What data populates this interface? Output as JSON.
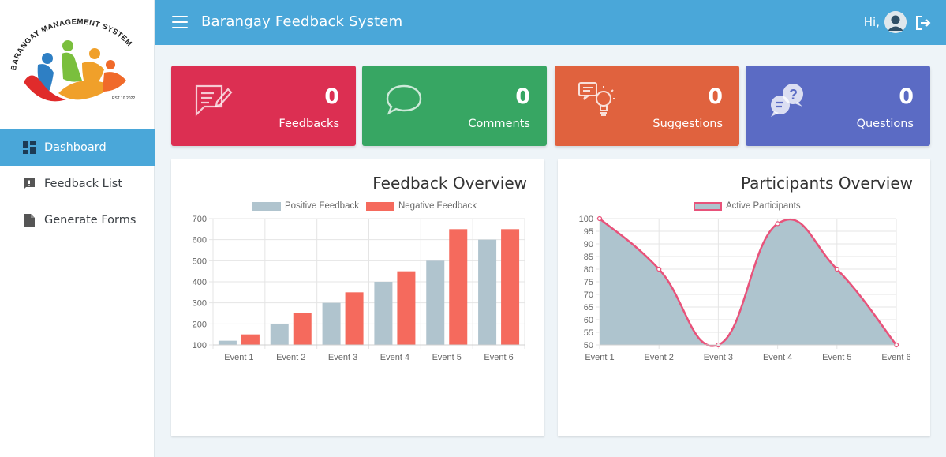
{
  "header": {
    "app_title": "Barangay Feedback System",
    "greeting": "Hi,"
  },
  "logo": {
    "text": "BARANGAY MANAGEMENT SYSTEM",
    "est": "EST 10 2022"
  },
  "sidebar": {
    "items": [
      {
        "label": "Dashboard",
        "icon": "dashboard-icon",
        "active": true
      },
      {
        "label": "Feedback List",
        "icon": "feedback-icon",
        "active": false
      },
      {
        "label": "Generate Forms",
        "icon": "file-icon",
        "active": false
      }
    ]
  },
  "cards": [
    {
      "value": "0",
      "label": "Feedbacks",
      "color": "#dc2f52",
      "icon": "pencil-note-icon"
    },
    {
      "value": "0",
      "label": "Comments",
      "color": "#37a663",
      "icon": "speech-bubble-icon"
    },
    {
      "value": "0",
      "label": "Suggestions",
      "color": "#e0623e",
      "icon": "lightbulb-icon"
    },
    {
      "value": "0",
      "label": "Questions",
      "color": "#5b6bc4",
      "icon": "question-bubbles-icon"
    }
  ],
  "charts": {
    "feedback_title": "Feedback Overview",
    "participants_title": "Participants Overview"
  },
  "chart_data": [
    {
      "type": "bar",
      "title": "Feedback Overview",
      "categories": [
        "Event 1",
        "Event 2",
        "Event 3",
        "Event 4",
        "Event 5",
        "Event 6"
      ],
      "series": [
        {
          "name": "Positive Feedback",
          "values": [
            120,
            200,
            300,
            400,
            500,
            600
          ],
          "color": "#b0c4ce"
        },
        {
          "name": "Negative Feedback",
          "values": [
            150,
            250,
            350,
            450,
            650,
            650
          ],
          "color": "#f56a5d"
        }
      ],
      "ylim": [
        100,
        700
      ],
      "yticks": [
        "100",
        "200",
        "300",
        "400",
        "500",
        "600",
        "700"
      ],
      "legend": "top-center",
      "grid": true
    },
    {
      "type": "area",
      "title": "Participants Overview",
      "categories": [
        "Event 1",
        "Event 2",
        "Event 3",
        "Event 4",
        "Event 5",
        "Event 6"
      ],
      "series": [
        {
          "name": "Active Participants",
          "values": [
            100,
            80,
            50,
            98,
            80,
            50
          ],
          "color": "#e8527a",
          "fill": "#aec4ce"
        }
      ],
      "ylim": [
        50,
        100
      ],
      "yticks": [
        "50",
        "55",
        "60",
        "65",
        "70",
        "75",
        "80",
        "85",
        "90",
        "95",
        "100"
      ],
      "legend": "top-center",
      "grid": true
    }
  ]
}
